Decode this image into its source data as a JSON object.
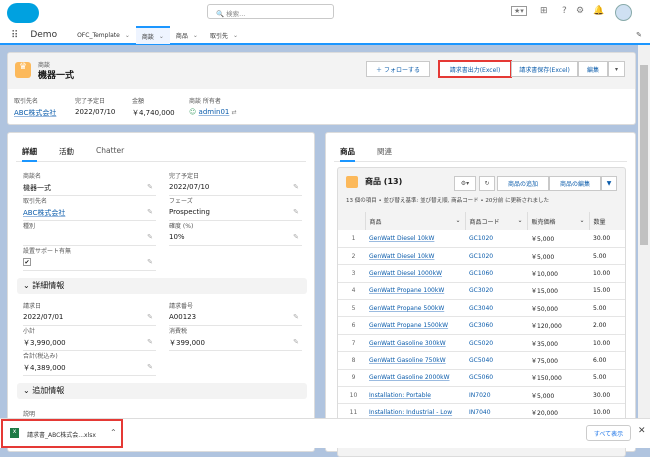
{
  "header": {
    "search_placeholder": "検索...",
    "app_name": "Demo",
    "tabs": [
      {
        "label": "OFC_Template"
      },
      {
        "label": "商談"
      },
      {
        "label": "商品"
      },
      {
        "label": "取引先"
      }
    ]
  },
  "record": {
    "object": "商談",
    "title": "機器一式",
    "buttons": {
      "follow": "＋ フォローする",
      "invoice_output": "請求書出力(Excel)",
      "invoice_save": "請求書保存(Excel)",
      "edit": "編集"
    },
    "highlights": [
      {
        "label": "取引先名",
        "value": "ABC株式会社"
      },
      {
        "label": "完了予定日",
        "value": "2022/07/10"
      },
      {
        "label": "金額",
        "value": "￥4,740,000"
      },
      {
        "label": "商談 所有者",
        "value": "admin01"
      }
    ]
  },
  "detail": {
    "tabs": [
      "詳細",
      "活動",
      "Chatter"
    ],
    "fields": [
      {
        "label": "商談名",
        "value": "機器一式"
      },
      {
        "label": "完了予定日",
        "value": "2022/07/10"
      },
      {
        "label": "取引先名",
        "value": "ABC株式会社"
      },
      {
        "label": "フェーズ",
        "value": "Prospecting"
      },
      {
        "label": "種別",
        "value": ""
      },
      {
        "label": "確度 (%)",
        "value": "10%"
      },
      {
        "label": "設置サポート有無",
        "value": "✔"
      }
    ],
    "section1": "詳細情報",
    "fields2": [
      {
        "label": "請求日",
        "value": "2022/07/01"
      },
      {
        "label": "請求番号",
        "value": "A00123"
      },
      {
        "label": "小計",
        "value": "￥3,990,000"
      },
      {
        "label": "消費税",
        "value": "￥399,000"
      },
      {
        "label": "合計(税込み)",
        "value": "￥4,389,000"
      }
    ],
    "section2": "追加情報",
    "desc_label": "説明"
  },
  "related": {
    "tabs": [
      "商品",
      "関連"
    ],
    "title": "商品 (13)",
    "buttons": {
      "add": "商品の追加",
      "edit": "商品の編集"
    },
    "meta": "13 個の項目 • 並び替え基準: 並び替え順, 商品コード • 20分前 に更新されました",
    "columns": [
      "商品",
      "商品コード",
      "販売価格",
      "数量"
    ],
    "rows": [
      [
        "1",
        "GenWatt Diesel 10kW",
        "GC1020",
        "￥5,000",
        "30.00"
      ],
      [
        "2",
        "GenWatt Diesel 10kW",
        "GC1020",
        "￥5,000",
        "5.00"
      ],
      [
        "3",
        "GenWatt Diesel 1000kW",
        "GC1060",
        "￥10,000",
        "10.00"
      ],
      [
        "4",
        "GenWatt Propane 100kW",
        "GC3020",
        "￥15,000",
        "15.00"
      ],
      [
        "5",
        "GenWatt Propane 500kW",
        "GC3040",
        "￥50,000",
        "5.00"
      ],
      [
        "6",
        "GenWatt Propane 1500kW",
        "GC3060",
        "￥120,000",
        "2.00"
      ],
      [
        "7",
        "GenWatt Gasoline 300kW",
        "GC5020",
        "￥35,000",
        "10.00"
      ],
      [
        "8",
        "GenWatt Gasoline 750kW",
        "GC5040",
        "￥75,000",
        "6.00"
      ],
      [
        "9",
        "GenWatt Gasoline 2000kW",
        "GC5060",
        "￥150,000",
        "5.00"
      ],
      [
        "10",
        "Installation: Portable",
        "IN7020",
        "￥5,000",
        "30.00"
      ],
      [
        "11",
        "Installation: Industrial - Low",
        "IN7040",
        "￥20,000",
        "10.00"
      ]
    ]
  },
  "download": {
    "file": "請求書_ABC株式会...xlsx",
    "show_all": "すべて表示"
  }
}
